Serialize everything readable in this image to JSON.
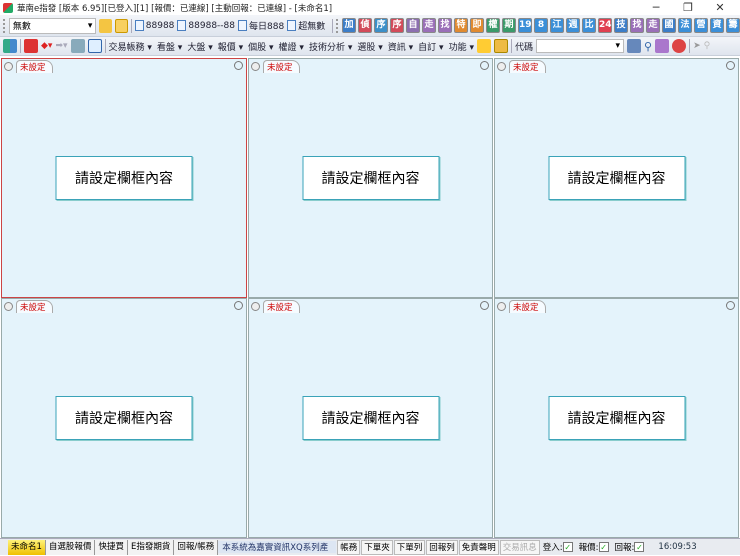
{
  "window": {
    "title": "華南e指發 [版本 6.95][已登入][1] [報價：已連線] [主動回報：已連線] - [未命名1]",
    "minimize": "─",
    "maximize": "❐",
    "close": "✕"
  },
  "toolbar1": {
    "account_select": "無數",
    "bookmarks": [
      "88988",
      "88988--88",
      "每日888",
      "超無數"
    ],
    "icon_buttons": [
      {
        "label": "加",
        "color": "#3b7dc8"
      },
      {
        "label": "偵",
        "color": "#d24b5a"
      },
      {
        "label": "序",
        "color": "#3b8fc8"
      },
      {
        "label": "序",
        "color": "#d24b5a"
      },
      {
        "label": "自",
        "color": "#8c6fb0"
      },
      {
        "label": "走",
        "color": "#9a6fb8"
      },
      {
        "label": "找",
        "color": "#9a6fb8"
      },
      {
        "label": "特",
        "color": "#e08a30"
      },
      {
        "label": "即",
        "color": "#e08a30"
      },
      {
        "label": "權",
        "color": "#3a9a6a"
      },
      {
        "label": "期",
        "color": "#3a9a6a"
      },
      {
        "label": "19",
        "color": "#3b8fd8"
      },
      {
        "label": "8",
        "color": "#3b8fd8"
      },
      {
        "label": "江",
        "color": "#3b8fd8"
      },
      {
        "label": "週",
        "color": "#3b8fd8"
      },
      {
        "label": "比",
        "color": "#3b8fd8"
      },
      {
        "label": "24",
        "color": "#e04050"
      },
      {
        "label": "技",
        "color": "#3b7dc8"
      },
      {
        "label": "找",
        "color": "#9a6fb8"
      },
      {
        "label": "走",
        "color": "#9a6fb8"
      },
      {
        "label": "國",
        "color": "#3b7dc8"
      },
      {
        "label": "法",
        "color": "#3b8fd8"
      },
      {
        "label": "營",
        "color": "#3b8fd8"
      },
      {
        "label": "資",
        "color": "#3b8fd8"
      },
      {
        "label": "籌",
        "color": "#3b8fd8"
      }
    ]
  },
  "toolbar2": {
    "menus": [
      "交易帳務",
      "看盤",
      "大盤",
      "報價",
      "個股",
      "權證",
      "技術分析",
      "選股",
      "資訊",
      "自訂",
      "功能"
    ],
    "code_label": "代碼",
    "code_value": ""
  },
  "panels": [
    {
      "tab": "未設定",
      "message": "請設定欄框內容"
    },
    {
      "tab": "未設定",
      "message": "請設定欄框內容"
    },
    {
      "tab": "未設定",
      "message": "請設定欄框內容"
    },
    {
      "tab": "未設定",
      "message": "請設定欄框內容"
    },
    {
      "tab": "未設定",
      "message": "請設定欄框內容"
    },
    {
      "tab": "未設定",
      "message": "請設定欄框內容"
    }
  ],
  "status": {
    "tabs": [
      "未命名1",
      "自選股報價",
      "快捷買",
      "E指發期貨",
      "回報/帳務"
    ],
    "marquee": "本系統為嘉實資訊XQ系列產",
    "buttons": [
      "帳務",
      "下單夾",
      "下單列",
      "回報列",
      "免責聲明",
      "交易訊息"
    ],
    "indicators": [
      {
        "label": "登入:",
        "checked": "✓"
      },
      {
        "label": "報價:",
        "checked": "✓"
      },
      {
        "label": "回報:",
        "checked": "✓"
      }
    ],
    "time": "16:09:53"
  },
  "colors": {
    "accent": "#c44",
    "panel_bg": "#e4f3fb",
    "box_border": "#3aa3b8"
  }
}
